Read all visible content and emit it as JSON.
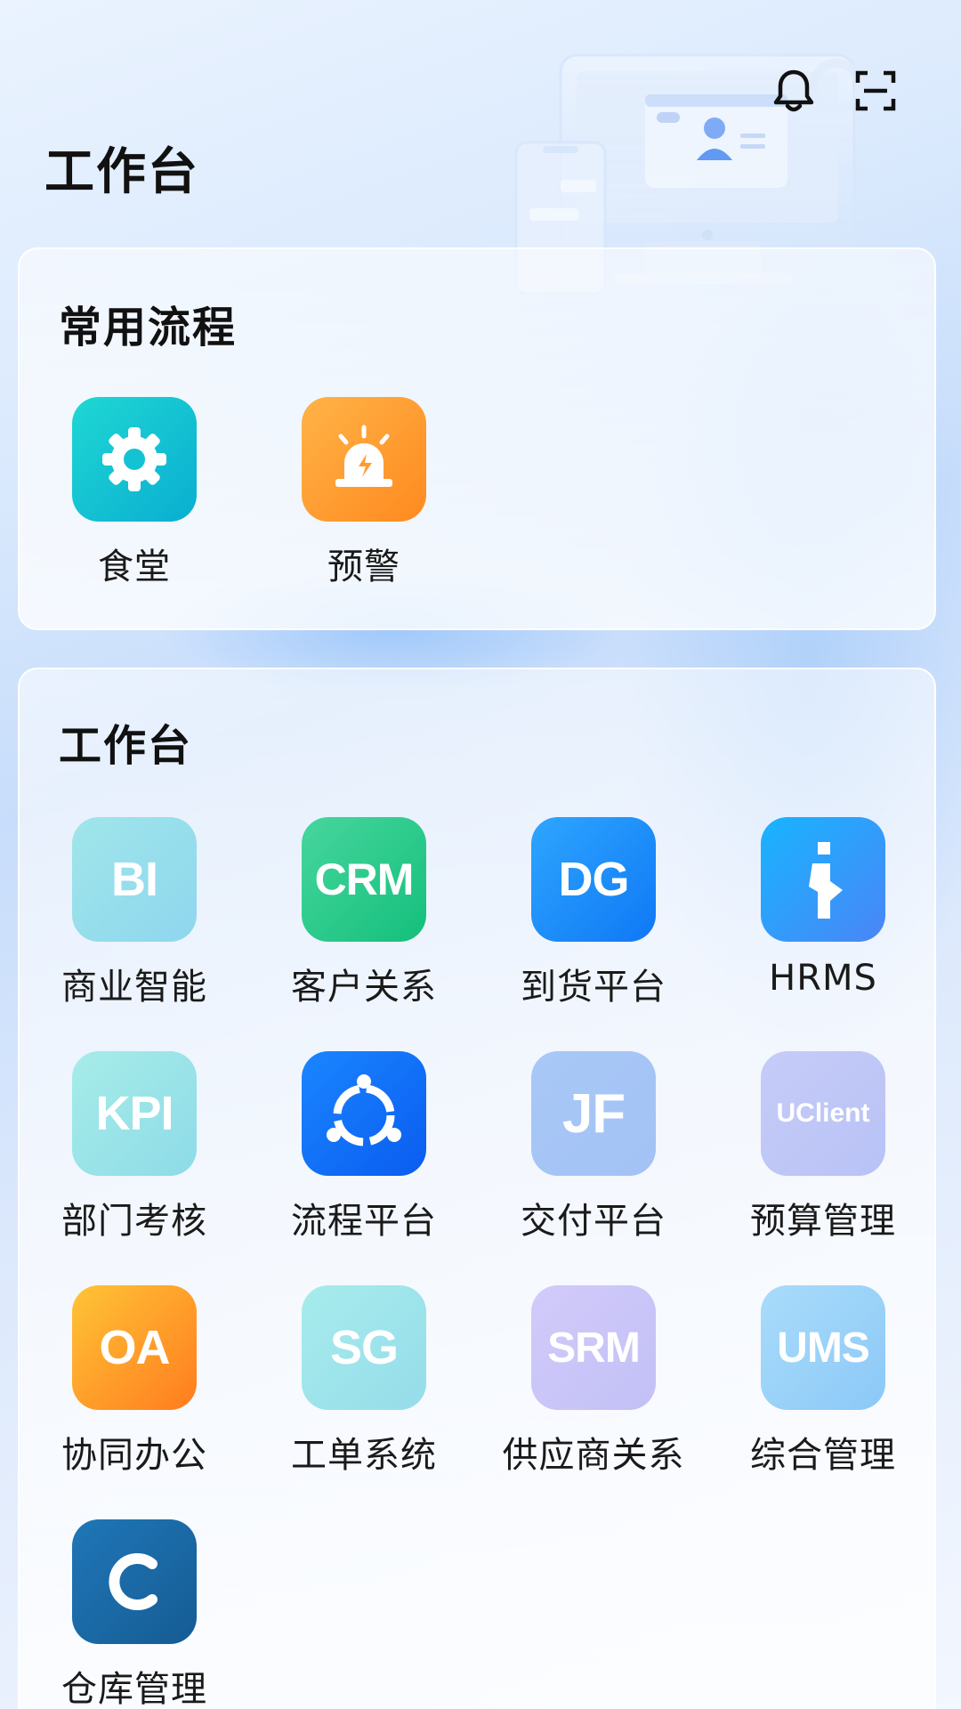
{
  "page": {
    "title": "工作台"
  },
  "header": {
    "icons": [
      "bell-icon",
      "scan-icon"
    ]
  },
  "common": {
    "title": "常用流程",
    "items": [
      {
        "label": "食堂",
        "icon": "gear-icon",
        "color_from": "#1fd7d4",
        "color_to": "#0aaed1"
      },
      {
        "label": "预警",
        "icon": "alarm-icon",
        "color_from": "#ffb347",
        "color_to": "#ff8a1f"
      }
    ]
  },
  "work": {
    "title": "工作台",
    "items": [
      {
        "label": "商业智能",
        "icon_text": "BI",
        "color_from": "#9fe6ea",
        "color_to": "#8fd6ee"
      },
      {
        "label": "客户关系",
        "icon_text": "CRM",
        "color_from": "#47d69d",
        "color_to": "#14bf7c"
      },
      {
        "label": "到货平台",
        "icon_text": "DG",
        "color_from": "#2ea6ff",
        "color_to": "#0f78f5"
      },
      {
        "label": "HRMS",
        "icon_text": "i",
        "color_from": "#18b4ff",
        "color_to": "#4a86f7"
      },
      {
        "label": "部门考核",
        "icon_text": "KPI",
        "color_from": "#a6ece9",
        "color_to": "#8edbe7"
      },
      {
        "label": "流程平台",
        "icon_text": "",
        "color_from": "#1a86ff",
        "color_to": "#0a5cf0"
      },
      {
        "label": "交付平台",
        "icon_text": "JF",
        "color_from": "#a8c8f7",
        "color_to": "#a3c2f5"
      },
      {
        "label": "预算管理",
        "icon_text": "UClient",
        "color_from": "#c6ccf8",
        "color_to": "#b8c2f5"
      },
      {
        "label": "协同办公",
        "icon_text": "OA",
        "color_from": "#ffc436",
        "color_to": "#ff7c1f"
      },
      {
        "label": "工单系统",
        "icon_text": "SG",
        "color_from": "#a6ecec",
        "color_to": "#96dcea"
      },
      {
        "label": "供应商关系",
        "icon_text": "SRM",
        "color_from": "#d2cbfa",
        "color_to": "#c2c0f6"
      },
      {
        "label": "综合管理",
        "icon_text": "UMS",
        "color_from": "#a9dcfa",
        "color_to": "#8cc8f7"
      },
      {
        "label": "仓库管理",
        "icon_text": "C",
        "color_from": "#1f76b7",
        "color_to": "#155c94"
      }
    ]
  }
}
